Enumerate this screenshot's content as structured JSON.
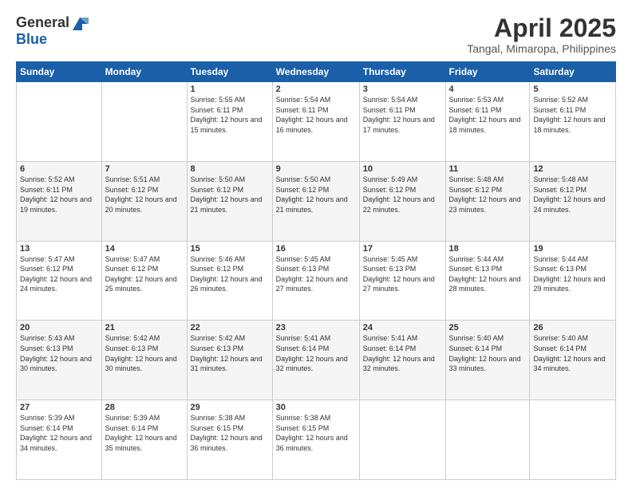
{
  "header": {
    "logo_general": "General",
    "logo_blue": "Blue",
    "month_title": "April 2025",
    "location": "Tangal, Mimaropa, Philippines"
  },
  "days_of_week": [
    "Sunday",
    "Monday",
    "Tuesday",
    "Wednesday",
    "Thursday",
    "Friday",
    "Saturday"
  ],
  "weeks": [
    [
      {
        "day": "",
        "info": ""
      },
      {
        "day": "",
        "info": ""
      },
      {
        "day": "1",
        "info": "Sunrise: 5:55 AM\nSunset: 6:11 PM\nDaylight: 12 hours and 15 minutes."
      },
      {
        "day": "2",
        "info": "Sunrise: 5:54 AM\nSunset: 6:11 PM\nDaylight: 12 hours and 16 minutes."
      },
      {
        "day": "3",
        "info": "Sunrise: 5:54 AM\nSunset: 6:11 PM\nDaylight: 12 hours and 17 minutes."
      },
      {
        "day": "4",
        "info": "Sunrise: 5:53 AM\nSunset: 6:11 PM\nDaylight: 12 hours and 18 minutes."
      },
      {
        "day": "5",
        "info": "Sunrise: 5:52 AM\nSunset: 6:11 PM\nDaylight: 12 hours and 18 minutes."
      }
    ],
    [
      {
        "day": "6",
        "info": "Sunrise: 5:52 AM\nSunset: 6:11 PM\nDaylight: 12 hours and 19 minutes."
      },
      {
        "day": "7",
        "info": "Sunrise: 5:51 AM\nSunset: 6:12 PM\nDaylight: 12 hours and 20 minutes."
      },
      {
        "day": "8",
        "info": "Sunrise: 5:50 AM\nSunset: 6:12 PM\nDaylight: 12 hours and 21 minutes."
      },
      {
        "day": "9",
        "info": "Sunrise: 5:50 AM\nSunset: 6:12 PM\nDaylight: 12 hours and 21 minutes."
      },
      {
        "day": "10",
        "info": "Sunrise: 5:49 AM\nSunset: 6:12 PM\nDaylight: 12 hours and 22 minutes."
      },
      {
        "day": "11",
        "info": "Sunrise: 5:48 AM\nSunset: 6:12 PM\nDaylight: 12 hours and 23 minutes."
      },
      {
        "day": "12",
        "info": "Sunrise: 5:48 AM\nSunset: 6:12 PM\nDaylight: 12 hours and 24 minutes."
      }
    ],
    [
      {
        "day": "13",
        "info": "Sunrise: 5:47 AM\nSunset: 6:12 PM\nDaylight: 12 hours and 24 minutes."
      },
      {
        "day": "14",
        "info": "Sunrise: 5:47 AM\nSunset: 6:12 PM\nDaylight: 12 hours and 25 minutes."
      },
      {
        "day": "15",
        "info": "Sunrise: 5:46 AM\nSunset: 6:12 PM\nDaylight: 12 hours and 26 minutes."
      },
      {
        "day": "16",
        "info": "Sunrise: 5:45 AM\nSunset: 6:13 PM\nDaylight: 12 hours and 27 minutes."
      },
      {
        "day": "17",
        "info": "Sunrise: 5:45 AM\nSunset: 6:13 PM\nDaylight: 12 hours and 27 minutes."
      },
      {
        "day": "18",
        "info": "Sunrise: 5:44 AM\nSunset: 6:13 PM\nDaylight: 12 hours and 28 minutes."
      },
      {
        "day": "19",
        "info": "Sunrise: 5:44 AM\nSunset: 6:13 PM\nDaylight: 12 hours and 29 minutes."
      }
    ],
    [
      {
        "day": "20",
        "info": "Sunrise: 5:43 AM\nSunset: 6:13 PM\nDaylight: 12 hours and 30 minutes."
      },
      {
        "day": "21",
        "info": "Sunrise: 5:42 AM\nSunset: 6:13 PM\nDaylight: 12 hours and 30 minutes."
      },
      {
        "day": "22",
        "info": "Sunrise: 5:42 AM\nSunset: 6:13 PM\nDaylight: 12 hours and 31 minutes."
      },
      {
        "day": "23",
        "info": "Sunrise: 5:41 AM\nSunset: 6:14 PM\nDaylight: 12 hours and 32 minutes."
      },
      {
        "day": "24",
        "info": "Sunrise: 5:41 AM\nSunset: 6:14 PM\nDaylight: 12 hours and 32 minutes."
      },
      {
        "day": "25",
        "info": "Sunrise: 5:40 AM\nSunset: 6:14 PM\nDaylight: 12 hours and 33 minutes."
      },
      {
        "day": "26",
        "info": "Sunrise: 5:40 AM\nSunset: 6:14 PM\nDaylight: 12 hours and 34 minutes."
      }
    ],
    [
      {
        "day": "27",
        "info": "Sunrise: 5:39 AM\nSunset: 6:14 PM\nDaylight: 12 hours and 34 minutes."
      },
      {
        "day": "28",
        "info": "Sunrise: 5:39 AM\nSunset: 6:14 PM\nDaylight: 12 hours and 35 minutes."
      },
      {
        "day": "29",
        "info": "Sunrise: 5:38 AM\nSunset: 6:15 PM\nDaylight: 12 hours and 36 minutes."
      },
      {
        "day": "30",
        "info": "Sunrise: 5:38 AM\nSunset: 6:15 PM\nDaylight: 12 hours and 36 minutes."
      },
      {
        "day": "",
        "info": ""
      },
      {
        "day": "",
        "info": ""
      },
      {
        "day": "",
        "info": ""
      }
    ]
  ]
}
